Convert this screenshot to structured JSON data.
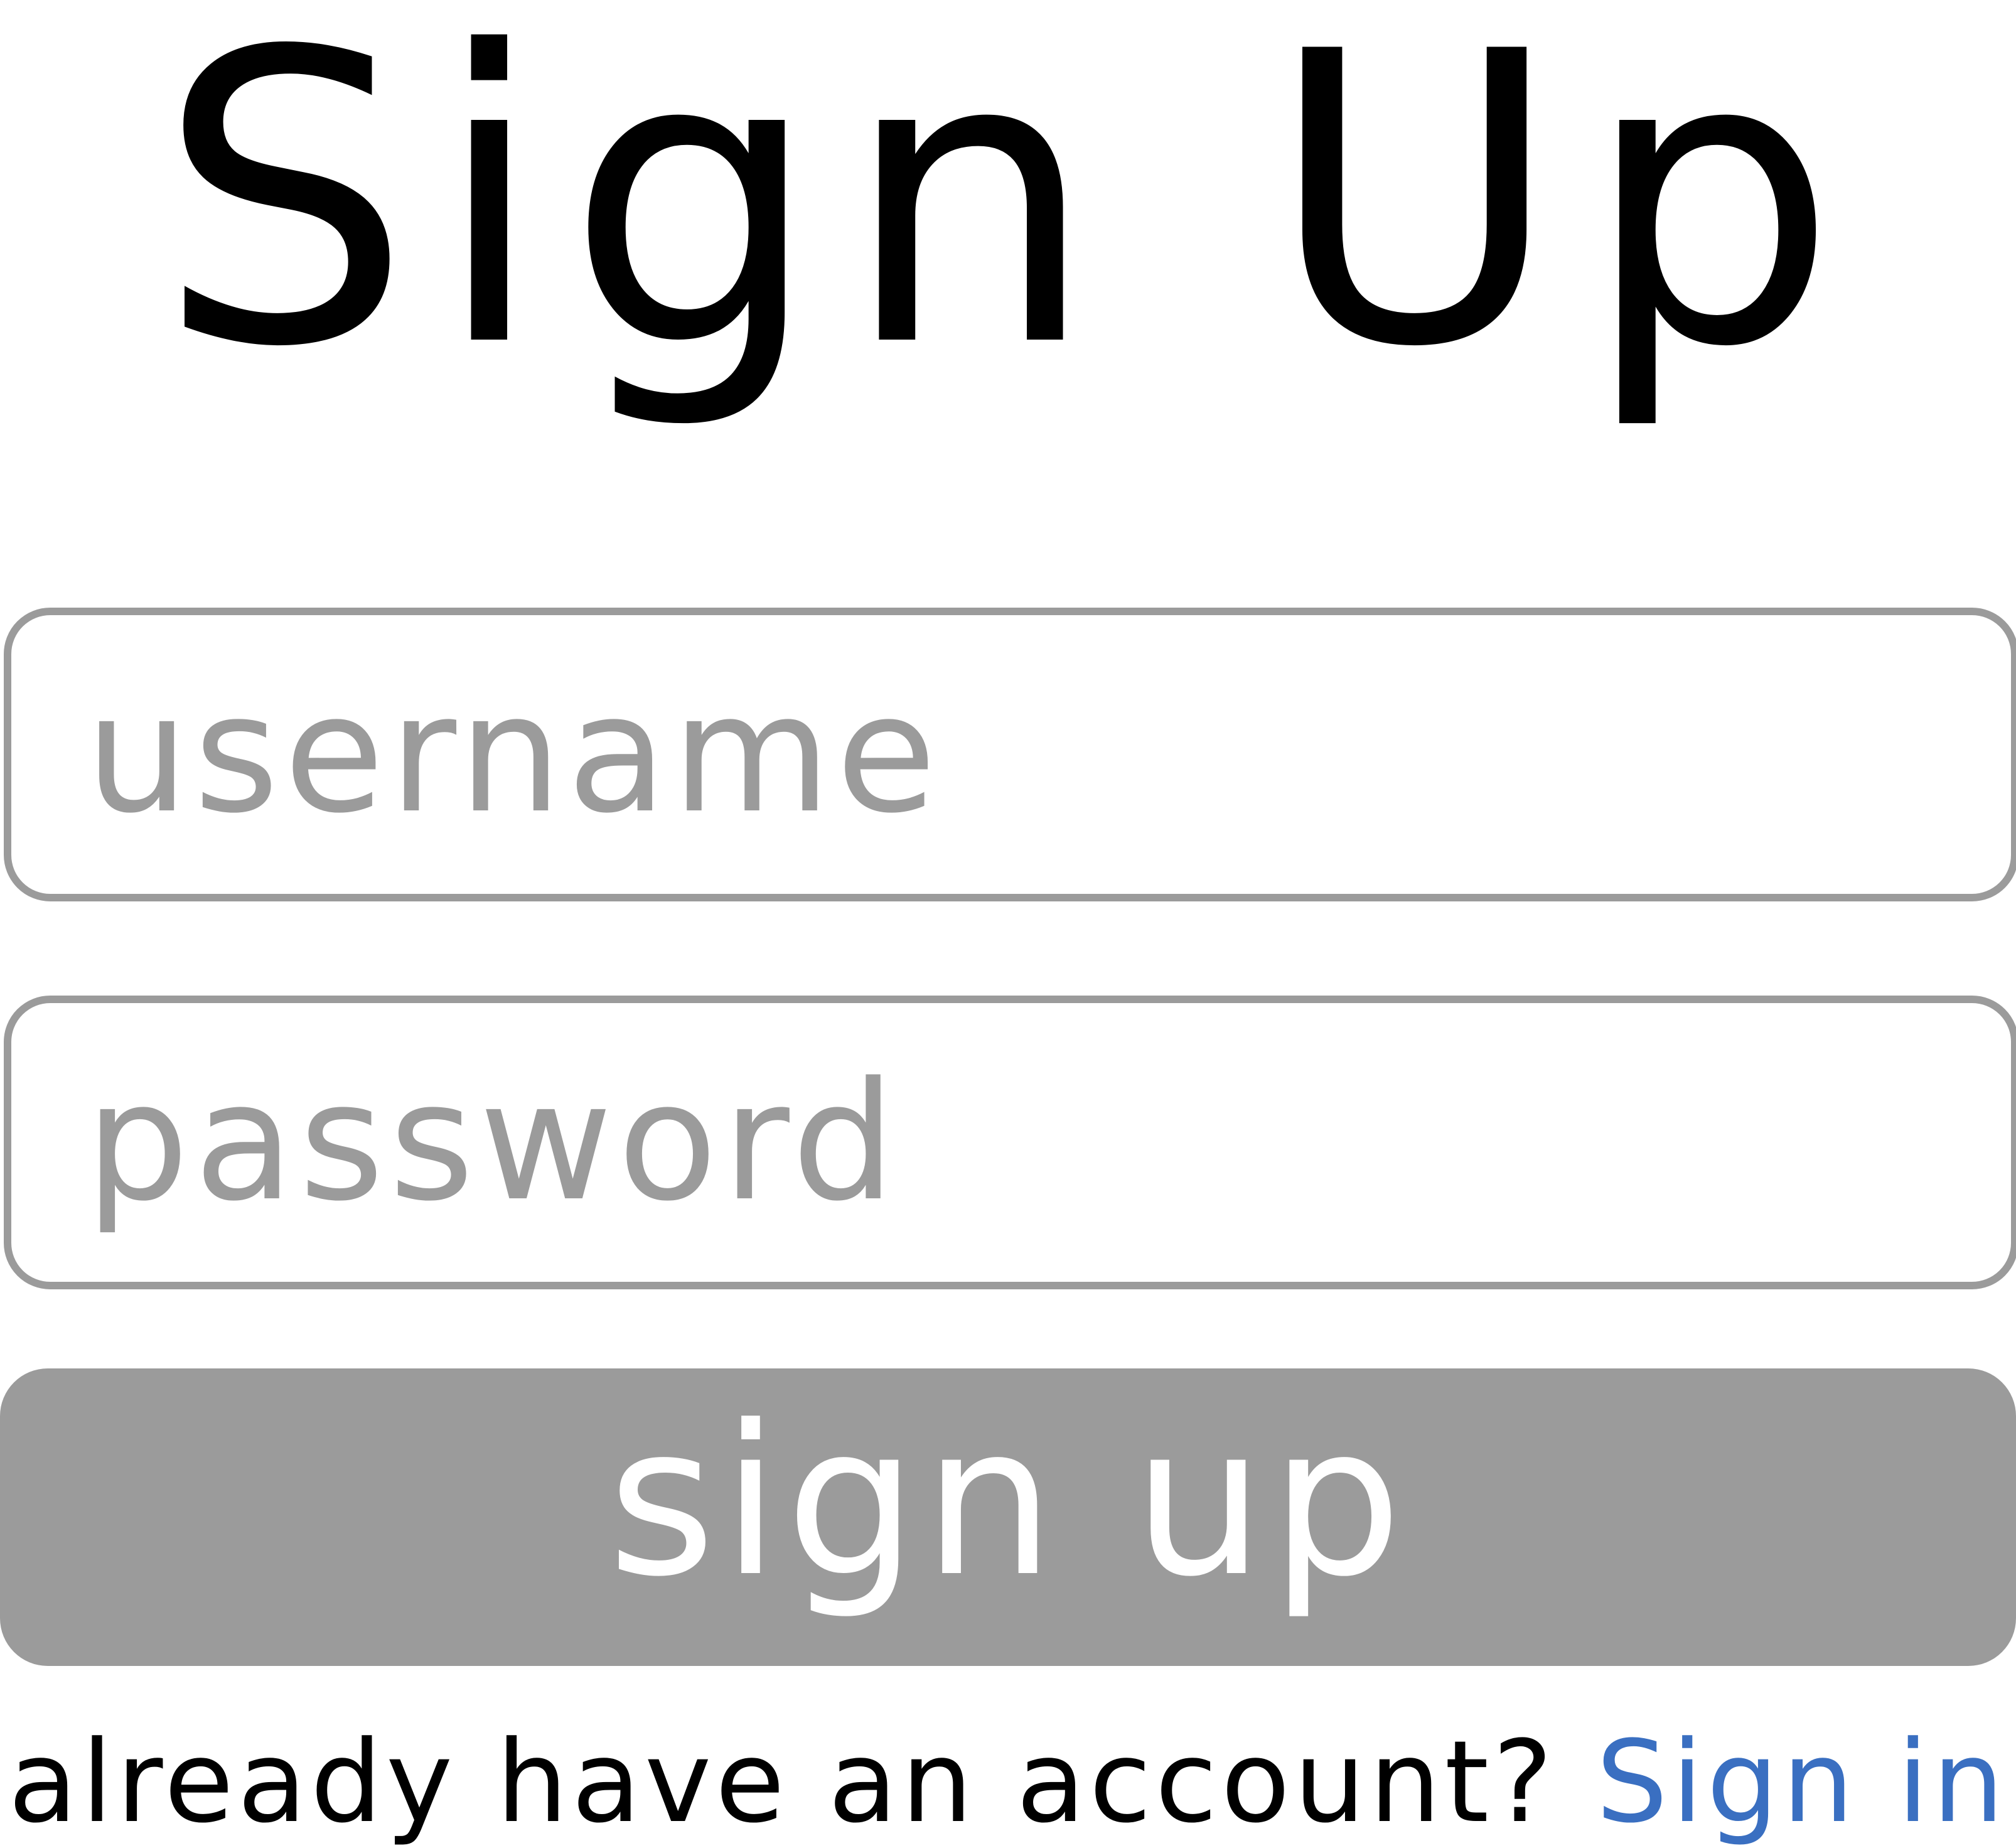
{
  "page": {
    "title": "Sign Up"
  },
  "form": {
    "username": {
      "placeholder": "username",
      "value": ""
    },
    "password": {
      "placeholder": "password",
      "value": ""
    },
    "submit_label": "sign up"
  },
  "footer": {
    "prompt": "already have an account?",
    "signin_link": "Sign in"
  },
  "colors": {
    "field_border": "#9b9b9b",
    "placeholder_text": "#9b9b9b",
    "button_background": "#9b9b9b",
    "button_text": "#ffffff",
    "link": "#3a6fc1",
    "title_text": "#000000"
  }
}
